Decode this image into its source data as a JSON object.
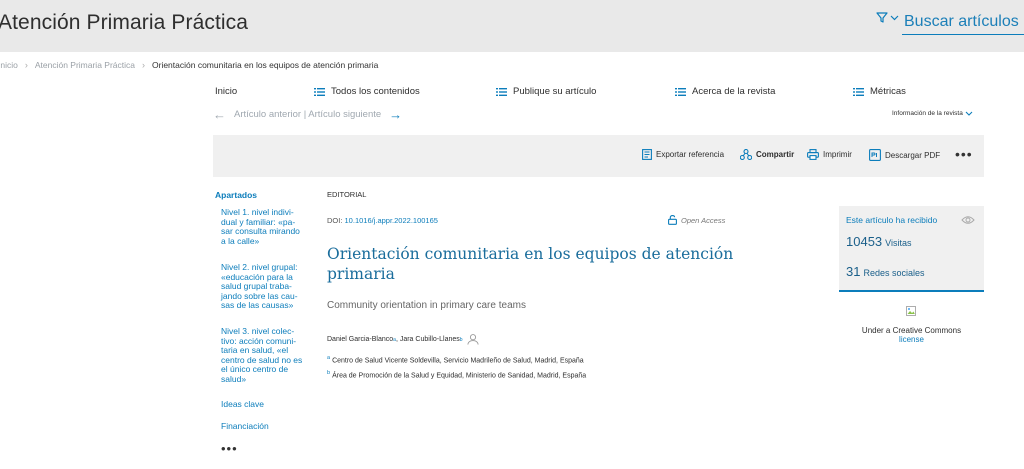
{
  "header": {
    "journal_title": "Atención Primaria Práctica",
    "search_placeholder": "Buscar artículos",
    "filter_icon": "filter-icon"
  },
  "breadcrumb": [
    {
      "label": "Inicio",
      "link": true
    },
    {
      "label": "Atención Primaria Práctica",
      "link": true
    },
    {
      "label": "Orientación comunitaria en los equipos de atención primaria",
      "link": false
    }
  ],
  "nav": {
    "home": "Inicio",
    "all_content": "Todos los contenidos",
    "publish": "Publique su artículo",
    "about": "Acerca de la revista",
    "metrics": "Métricas"
  },
  "article_nav": {
    "prev_next": "Artículo anterior | Artículo siguiente",
    "journal_info": "Información de la revista"
  },
  "toolbar": {
    "export": "Exportar referencia",
    "share": "Compartir",
    "print": "Imprimir",
    "download": "Descargar PDF",
    "more": "•••"
  },
  "sections": {
    "title": "Apartados",
    "items": [
      {
        "lines": [
          "Nivel 1. nivel indivi-",
          "dual y familiar: «pa-",
          "sar consulta mirando",
          "a la calle»"
        ]
      },
      {
        "lines": [
          "Nivel 2. nivel grupal:",
          "«educación para la",
          "salud grupal traba-",
          "jando sobre las cau-",
          "sas de las causas»"
        ]
      },
      {
        "lines": [
          "Nivel 3. nivel colec-",
          "tivo: acción comuni-",
          "taria en salud, «el",
          "centro de salud no es",
          "el único centro de",
          "salud»"
        ]
      },
      {
        "lines": [
          "Ideas clave"
        ]
      },
      {
        "lines": [
          "Financiación"
        ]
      }
    ],
    "more": "•••"
  },
  "article": {
    "type": "EDITORIAL",
    "doi_label": "DOI: ",
    "doi": "10.1016/j.appr.2022.100165",
    "open_access": "Open Access",
    "title_lines": [
      "Orientación comunitaria en los equipos de atención",
      "primaria"
    ],
    "subtitle": "Community orientation in primary care teams",
    "authors": [
      {
        "name": "Daniel Garcia-Blanco",
        "sup": "a"
      },
      {
        "name": "Jara Cubillo-Llanes",
        "sup": "b"
      }
    ],
    "affiliations": [
      {
        "sup": "a",
        "text": "Centro de Salud Vicente Soldevilla, Servicio Madrileño de Salud, Madrid, España"
      },
      {
        "sup": "b",
        "text": "Área de Promoción de la Salud y Equidad, Ministerio de Sanidad, Madrid, España"
      }
    ]
  },
  "stats": {
    "header": "Este artículo ha recibido",
    "visits_num": "10453",
    "visits_label": "Visitas",
    "social_num": "31",
    "social_label": "Redes sociales"
  },
  "license": {
    "text": "Under a Creative Commons",
    "link": "license"
  },
  "colors": {
    "accent": "#0c7dbb",
    "title": "#1a6d9c",
    "header_bg": "#e9e9e9",
    "panel_bg": "#f0f0f0"
  }
}
